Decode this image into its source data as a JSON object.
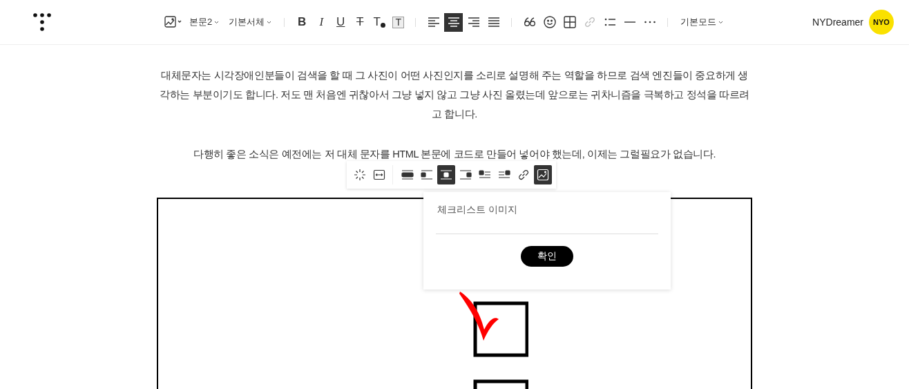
{
  "header": {
    "style_dropdowns": [
      {
        "label": "본문2"
      },
      {
        "label": "기본서체"
      }
    ],
    "format": [
      {
        "kind": "bold",
        "label": "B"
      },
      {
        "kind": "italic",
        "label": "I"
      },
      {
        "kind": "underline",
        "label": "U"
      },
      {
        "kind": "strike",
        "label": "T"
      },
      {
        "kind": "text-color",
        "label": "T"
      },
      {
        "kind": "text-background",
        "label": "T"
      }
    ],
    "align": [
      {
        "kind": "left",
        "selected": false
      },
      {
        "kind": "center",
        "selected": true
      },
      {
        "kind": "right",
        "selected": false
      },
      {
        "kind": "justify",
        "selected": false
      }
    ],
    "insert": [
      {
        "kind": "quote",
        "disabled": false
      },
      {
        "kind": "emoji",
        "disabled": false
      },
      {
        "kind": "table",
        "disabled": false
      },
      {
        "kind": "link",
        "disabled": true
      },
      {
        "kind": "list",
        "disabled": false
      },
      {
        "kind": "divider",
        "disabled": false
      },
      {
        "kind": "more",
        "disabled": false
      }
    ],
    "mode_dropdown": {
      "label": "기본모드"
    },
    "user": {
      "name": "NYDreamer",
      "avatar_text": "NYO"
    }
  },
  "paragraphs": [
    "대체문자는 시각장애인분들이 검색을 할 때 그 사진이 어떤 사진인지를 소리로 설명해 주는 역할을 하므로 검색 엔진들이 중요하게 생각하는 부분이기도 합니다.  저도 맨 처음엔 귀찮아서 그냥 넣지 않고 그냥 사진 올렸는데 앞으로는 귀차니즘을 극복하고 정석을 따르려고 합니다.",
    "다행히 좋은 소식은 예전에는 저 대체 문자를 HTML 본문에 코드로 만들어 넣어야 했는데, 이제는 그럴필요가 없습니다."
  ],
  "image_toolbar": {
    "size": [
      {
        "kind": "original"
      },
      {
        "kind": "fit-width"
      }
    ],
    "options": [
      {
        "kind": "full",
        "selected": false
      },
      {
        "kind": "left",
        "selected": false
      },
      {
        "kind": "center",
        "selected": true
      },
      {
        "kind": "right",
        "selected": false
      },
      {
        "kind": "float-left",
        "selected": false
      },
      {
        "kind": "float-right",
        "selected": false
      },
      {
        "kind": "link",
        "selected": false
      },
      {
        "kind": "alt-text",
        "selected": true
      }
    ]
  },
  "alt_popup": {
    "value": "체크리스트 이미지",
    "confirm": "확인"
  }
}
